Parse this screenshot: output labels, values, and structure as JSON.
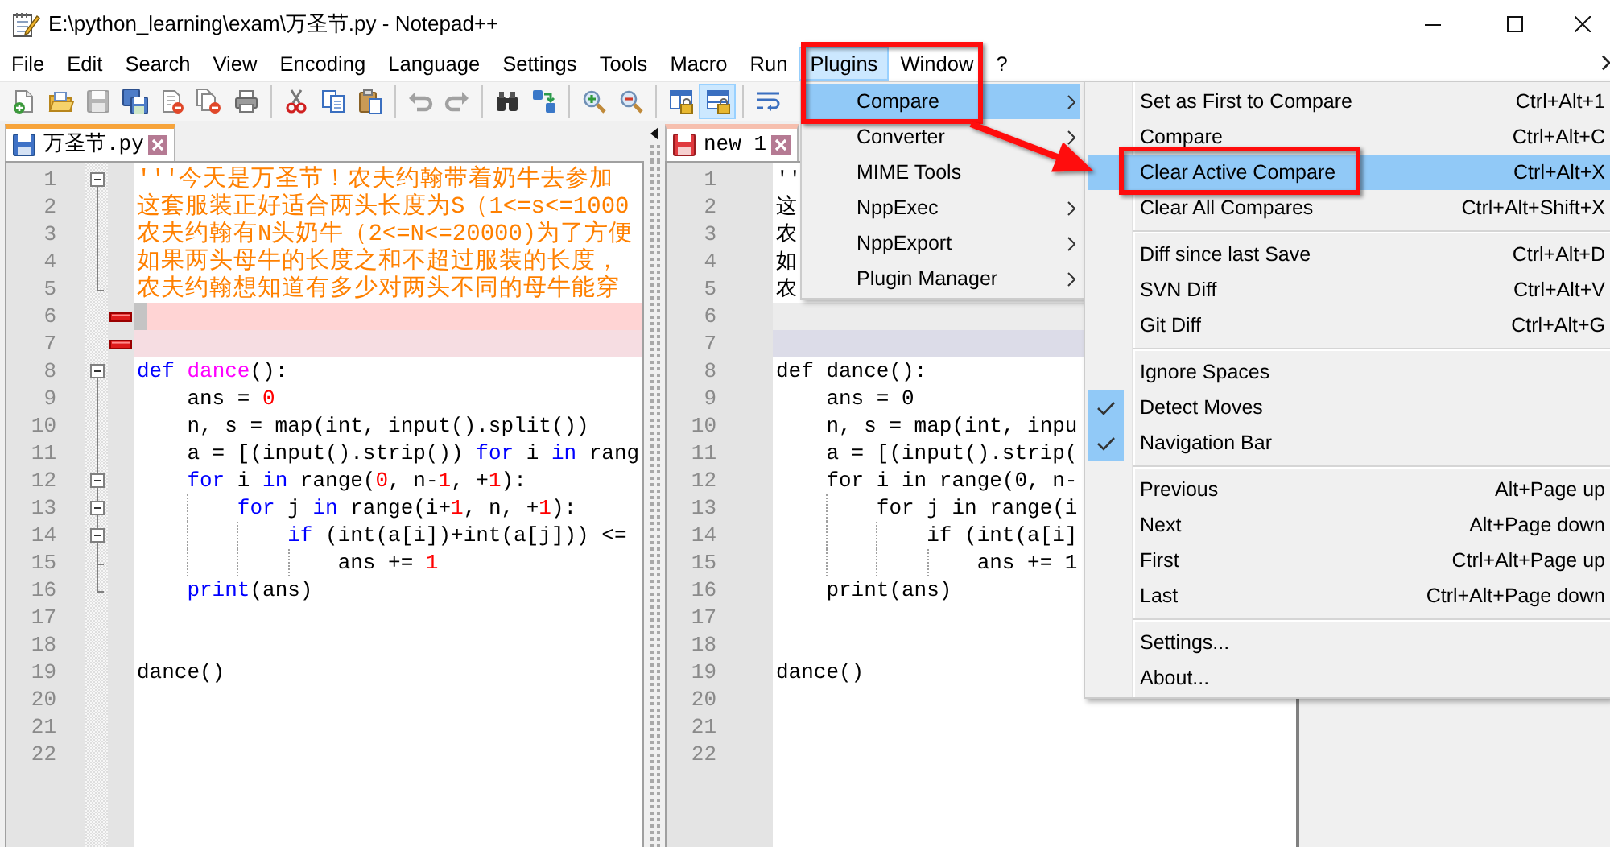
{
  "window": {
    "title": "E:\\python_learning\\exam\\万圣节.py - Notepad++"
  },
  "menu_bar": [
    {
      "label": "File",
      "selected": false
    },
    {
      "label": "Edit",
      "selected": false
    },
    {
      "label": "Search",
      "selected": false
    },
    {
      "label": "View",
      "selected": false
    },
    {
      "label": "Encoding",
      "selected": false
    },
    {
      "label": "Language",
      "selected": false
    },
    {
      "label": "Settings",
      "selected": false
    },
    {
      "label": "Tools",
      "selected": false
    },
    {
      "label": "Macro",
      "selected": false
    },
    {
      "label": "Run",
      "selected": false
    },
    {
      "label": "Plugins",
      "selected": true
    },
    {
      "label": "Window",
      "selected": false
    },
    {
      "label": "?",
      "selected": false
    }
  ],
  "toolbar": [
    [
      {
        "kind": "new",
        "pressed": false,
        "disabled": false
      },
      {
        "kind": "open",
        "pressed": false,
        "disabled": false
      },
      {
        "kind": "save",
        "pressed": false,
        "disabled": true
      },
      {
        "kind": "save-all",
        "pressed": false,
        "disabled": false
      },
      {
        "kind": "close",
        "pressed": false,
        "disabled": false
      },
      {
        "kind": "close-all",
        "pressed": false,
        "disabled": false
      },
      {
        "kind": "print",
        "pressed": false,
        "disabled": false
      }
    ],
    [
      {
        "kind": "cut",
        "pressed": false,
        "disabled": false
      },
      {
        "kind": "copy",
        "pressed": false,
        "disabled": false
      },
      {
        "kind": "paste",
        "pressed": false,
        "disabled": false
      }
    ],
    [
      {
        "kind": "undo",
        "pressed": false,
        "disabled": true
      },
      {
        "kind": "redo",
        "pressed": false,
        "disabled": true
      }
    ],
    [
      {
        "kind": "find",
        "pressed": false,
        "disabled": false
      },
      {
        "kind": "replace",
        "pressed": false,
        "disabled": false
      }
    ],
    [
      {
        "kind": "zoom-in",
        "pressed": false,
        "disabled": false
      },
      {
        "kind": "zoom-out",
        "pressed": false,
        "disabled": false
      }
    ],
    [
      {
        "kind": "sync-vertical",
        "pressed": false,
        "disabled": false
      },
      {
        "kind": "sync-horizontal",
        "pressed": true,
        "disabled": false
      }
    ],
    [
      {
        "kind": "word-wrap",
        "pressed": false,
        "disabled": false
      }
    ]
  ],
  "views": [
    {
      "focused": true,
      "tab": {
        "label": "万圣节.py",
        "modified": false
      },
      "lines": [
        {
          "number": "1",
          "kind": "code",
          "fold_marker": {
            "kind": "head"
          },
          "current": false,
          "tokens": [
            {
              "kind": "string",
              "text": "'''今天是万圣节！农夫约翰带着奶牛去参加"
            }
          ]
        },
        {
          "number": "2",
          "kind": "code",
          "fold_marker": {
            "kind": "line"
          },
          "current": false,
          "tokens": [
            {
              "kind": "string",
              "text": "这套服装正好适合两头长度为S（1<=s<=1000"
            }
          ]
        },
        {
          "number": "3",
          "kind": "code",
          "fold_marker": {
            "kind": "line"
          },
          "current": false,
          "tokens": [
            {
              "kind": "string",
              "text": "农夫约翰有N头奶牛（2<=N<=20000)为了方便"
            }
          ]
        },
        {
          "number": "4",
          "kind": "code",
          "fold_marker": {
            "kind": "line"
          },
          "current": false,
          "tokens": [
            {
              "kind": "string",
              "text": "如果两头母牛的长度之和不超过服装的长度，"
            }
          ]
        },
        {
          "number": "5",
          "kind": "code",
          "fold_marker": {
            "kind": "end"
          },
          "current": false,
          "tokens": [
            {
              "kind": "string",
              "text": "农夫约翰想知道有多少对两头不同的母牛能穿"
            }
          ]
        },
        {
          "number": "6",
          "kind": "removed",
          "current": true
        },
        {
          "number": "7",
          "kind": "removed",
          "current": false
        },
        {
          "number": "8",
          "kind": "code",
          "fold_marker": {
            "kind": "head"
          },
          "current": false,
          "tokens": [
            {
              "kind": "keyword",
              "text": "def "
            },
            {
              "kind": "function",
              "text": "dance"
            },
            {
              "kind": "plain",
              "text": "():"
            }
          ]
        },
        {
          "number": "9",
          "kind": "code",
          "fold_marker": {
            "kind": "line"
          },
          "current": false,
          "tokens": [
            {
              "kind": "plain",
              "text": "    ans = "
            },
            {
              "kind": "number",
              "text": "0"
            }
          ]
        },
        {
          "number": "10",
          "kind": "code",
          "fold_marker": {
            "kind": "line"
          },
          "current": false,
          "tokens": [
            {
              "kind": "plain",
              "text": "    n, s = map(int, input().split())"
            }
          ]
        },
        {
          "number": "11",
          "kind": "code",
          "fold_marker": {
            "kind": "line"
          },
          "current": false,
          "tokens": [
            {
              "kind": "plain",
              "text": "    a = [(input().strip()) "
            },
            {
              "kind": "keyword",
              "text": "for"
            },
            {
              "kind": "plain",
              "text": " i "
            },
            {
              "kind": "keyword",
              "text": "in"
            },
            {
              "kind": "plain",
              "text": " rang"
            }
          ]
        },
        {
          "number": "12",
          "kind": "code",
          "fold_marker": {
            "kind": "nested_head"
          },
          "current": false,
          "tokens": [
            {
              "kind": "keyword",
              "text": "    for"
            },
            {
              "kind": "plain",
              "text": " i "
            },
            {
              "kind": "keyword",
              "text": "in"
            },
            {
              "kind": "plain",
              "text": " range("
            },
            {
              "kind": "number",
              "text": "0"
            },
            {
              "kind": "plain",
              "text": ", n-"
            },
            {
              "kind": "number",
              "text": "1"
            },
            {
              "kind": "plain",
              "text": ", +"
            },
            {
              "kind": "number",
              "text": "1"
            },
            {
              "kind": "plain",
              "text": "):"
            }
          ]
        },
        {
          "number": "13",
          "kind": "code",
          "fold_marker": {
            "kind": "nested_head"
          },
          "current": false,
          "tokens": [
            {
              "kind": "keyword",
              "text": "        for"
            },
            {
              "kind": "plain",
              "text": " j "
            },
            {
              "kind": "keyword",
              "text": "in"
            },
            {
              "kind": "plain",
              "text": " range(i+"
            },
            {
              "kind": "number",
              "text": "1"
            },
            {
              "kind": "plain",
              "text": ", n, +"
            },
            {
              "kind": "number",
              "text": "1"
            },
            {
              "kind": "plain",
              "text": "):"
            }
          ]
        },
        {
          "number": "14",
          "kind": "code",
          "fold_marker": {
            "kind": "nested_head"
          },
          "current": false,
          "tokens": [
            {
              "kind": "keyword",
              "text": "            if"
            },
            {
              "kind": "plain",
              "text": " (int(a[i])+int(a[j])) <="
            }
          ]
        },
        {
          "number": "15",
          "kind": "code",
          "fold_marker": {
            "kind": "tee"
          },
          "current": false,
          "tokens": [
            {
              "kind": "plain",
              "text": "                ans += "
            },
            {
              "kind": "number",
              "text": "1"
            }
          ]
        },
        {
          "number": "16",
          "kind": "code",
          "fold_marker": {
            "kind": "end"
          },
          "current": false,
          "tokens": [
            {
              "kind": "keyword",
              "text": "    print"
            },
            {
              "kind": "plain",
              "text": "(ans)"
            }
          ]
        },
        {
          "number": "17",
          "kind": "code",
          "current": false
        },
        {
          "number": "18",
          "kind": "code",
          "current": false
        },
        {
          "number": "19",
          "kind": "code",
          "current": false,
          "tokens": [
            {
              "kind": "plain",
              "text": "dance()"
            }
          ]
        },
        {
          "number": "20",
          "kind": "code",
          "current": false
        },
        {
          "number": "21",
          "kind": "code",
          "current": false
        },
        {
          "number": "22",
          "kind": "code",
          "current": false
        }
      ]
    },
    {
      "focused": false,
      "tab": {
        "label": "new 1",
        "modified": true
      },
      "lines": [
        {
          "number": "1",
          "kind": "code",
          "current": false,
          "text": "''"
        },
        {
          "number": "2",
          "kind": "code",
          "current": false,
          "text": "这"
        },
        {
          "number": "3",
          "kind": "code",
          "current": false,
          "text": "农"
        },
        {
          "number": "4",
          "kind": "code",
          "current": false,
          "text": "如"
        },
        {
          "number": "5",
          "kind": "code",
          "current": false,
          "text": "农"
        },
        {
          "number": "6",
          "kind": "blank",
          "current": true
        },
        {
          "number": "7",
          "kind": "blank",
          "current": false
        },
        {
          "number": "8",
          "kind": "code",
          "current": false,
          "text": "def dance():"
        },
        {
          "number": "9",
          "kind": "code",
          "current": false,
          "text": "    ans = 0"
        },
        {
          "number": "10",
          "kind": "code",
          "current": false,
          "text": "    n, s = map(int, inpu"
        },
        {
          "number": "11",
          "kind": "code",
          "current": false,
          "text": "    a = [(input().strip("
        },
        {
          "number": "12",
          "kind": "code",
          "current": false,
          "text": "    for i in range(0, n-"
        },
        {
          "number": "13",
          "kind": "code",
          "current": false,
          "text": "        for j in range(i"
        },
        {
          "number": "14",
          "kind": "code",
          "current": false,
          "text": "            if (int(a[i]"
        },
        {
          "number": "15",
          "kind": "code",
          "current": false,
          "text": "                ans += 1"
        },
        {
          "number": "16",
          "kind": "code",
          "current": false,
          "text": "    print(ans)"
        },
        {
          "number": "17",
          "kind": "code",
          "current": false
        },
        {
          "number": "18",
          "kind": "code",
          "current": false
        },
        {
          "number": "19",
          "kind": "code",
          "current": false,
          "text": "dance()"
        },
        {
          "number": "20",
          "kind": "code",
          "current": false
        },
        {
          "number": "21",
          "kind": "code",
          "current": false
        },
        {
          "number": "22",
          "kind": "code",
          "current": false
        }
      ]
    }
  ],
  "plugins_menu": {
    "items": [
      {
        "label": "Compare",
        "selected": true,
        "submenu": true
      },
      {
        "label": "Converter",
        "selected": false,
        "submenu": true
      },
      {
        "label": "MIME Tools",
        "selected": false,
        "submenu": false
      },
      {
        "label": "NppExec",
        "selected": false,
        "submenu": true
      },
      {
        "label": "NppExport",
        "selected": false,
        "submenu": true
      },
      {
        "label": "Plugin Manager",
        "selected": false,
        "submenu": true
      }
    ]
  },
  "compare_submenu": {
    "groups": [
      [
        {
          "label": "Set as First to Compare",
          "shortcut": "Ctrl+Alt+1",
          "selected": false,
          "checked": false
        },
        {
          "label": "Compare",
          "shortcut": "Ctrl+Alt+C",
          "selected": false,
          "checked": false
        },
        {
          "label": "Clear Active Compare",
          "shortcut": "Ctrl+Alt+X",
          "selected": true,
          "checked": false
        },
        {
          "label": "Clear All Compares",
          "shortcut": "Ctrl+Alt+Shift+X",
          "selected": false,
          "checked": false
        }
      ],
      [
        {
          "label": "Diff since last Save",
          "shortcut": "Ctrl+Alt+D",
          "selected": false,
          "checked": false
        },
        {
          "label": "SVN Diff",
          "shortcut": "Ctrl+Alt+V",
          "selected": false,
          "checked": false
        },
        {
          "label": "Git Diff",
          "shortcut": "Ctrl+Alt+G",
          "selected": false,
          "checked": false
        }
      ],
      [
        {
          "label": "Ignore Spaces",
          "selected": false,
          "checked": false
        },
        {
          "label": "Detect Moves",
          "selected": false,
          "checked": true
        },
        {
          "label": "Navigation Bar",
          "selected": false,
          "checked": true
        }
      ],
      [
        {
          "label": "Previous",
          "shortcut": "Alt+Page up",
          "selected": false,
          "checked": false
        },
        {
          "label": "Next",
          "shortcut": "Alt+Page down",
          "selected": false,
          "checked": false
        },
        {
          "label": "First",
          "shortcut": "Ctrl+Alt+Page up",
          "selected": false,
          "checked": false
        },
        {
          "label": "Last",
          "shortcut": "Ctrl+Alt+Page down",
          "selected": false,
          "checked": false
        }
      ],
      [
        {
          "label": "Settings...",
          "selected": false,
          "checked": false
        },
        {
          "label": "About...",
          "selected": false,
          "checked": false
        }
      ]
    ]
  }
}
